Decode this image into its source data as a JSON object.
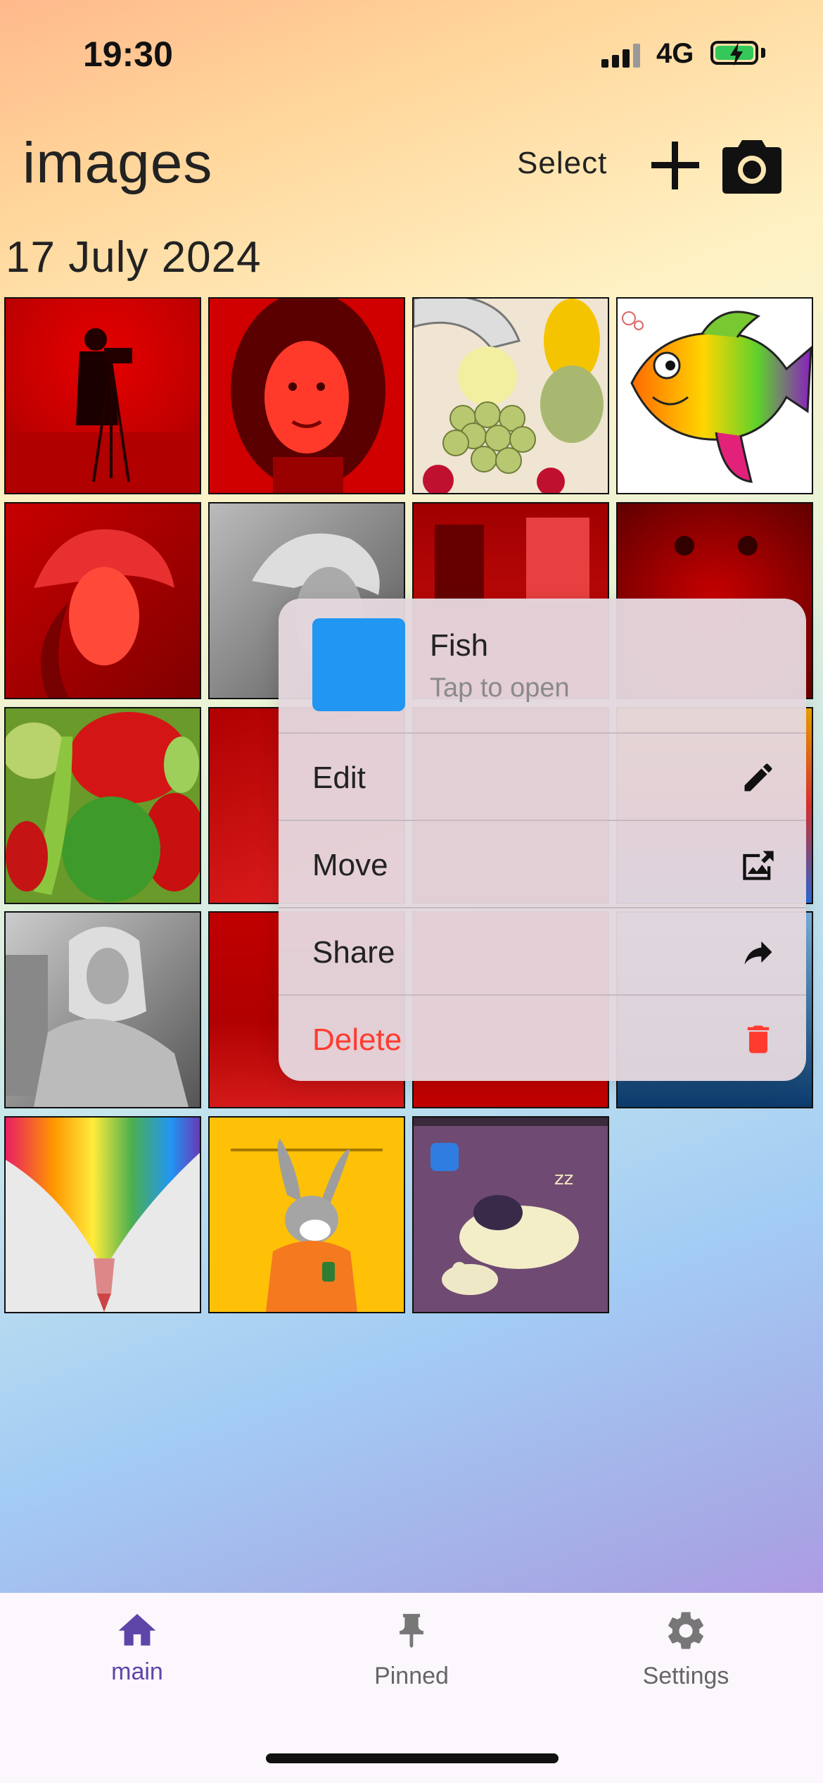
{
  "status_bar": {
    "time": "19:30",
    "network": "4G"
  },
  "header": {
    "title": "images",
    "select_label": "Select"
  },
  "date_group": "17 July 2024",
  "tiles": [
    {
      "name": "cameraman"
    },
    {
      "name": "woman-portrait"
    },
    {
      "name": "fruits"
    },
    {
      "name": "fish"
    },
    {
      "name": "lena-red"
    },
    {
      "name": "lena-gray"
    },
    {
      "name": "room-red"
    },
    {
      "name": "baboon-red"
    },
    {
      "name": "peppers"
    },
    {
      "name": "red-photo"
    },
    {
      "name": "red-photo-2"
    },
    {
      "name": "colorful-photo"
    },
    {
      "name": "barbara-gray"
    },
    {
      "name": "boats-red"
    },
    {
      "name": "red-photo-3"
    },
    {
      "name": "harbor-blue"
    },
    {
      "name": "pencil-splash"
    },
    {
      "name": "bugs-bunny"
    },
    {
      "name": "sleeping-cartoon"
    }
  ],
  "context_menu": {
    "preview_title": "Fish",
    "preview_subtitle": "Tap to open",
    "items": [
      {
        "label": "Edit",
        "icon": "pencil-icon"
      },
      {
        "label": "Move",
        "icon": "move-image-icon"
      },
      {
        "label": "Share",
        "icon": "share-icon"
      },
      {
        "label": "Delete",
        "icon": "trash-icon",
        "color": "#ff3b30"
      }
    ]
  },
  "bottom_nav": {
    "items": [
      {
        "label": "main",
        "icon": "home-icon",
        "active": true
      },
      {
        "label": "Pinned",
        "icon": "pin-icon",
        "active": false
      },
      {
        "label": "Settings",
        "icon": "gear-icon",
        "active": false
      }
    ]
  },
  "colors": {
    "accent": "#5e45a8",
    "danger": "#ff3b30",
    "preview_thumb": "#2196f3"
  }
}
